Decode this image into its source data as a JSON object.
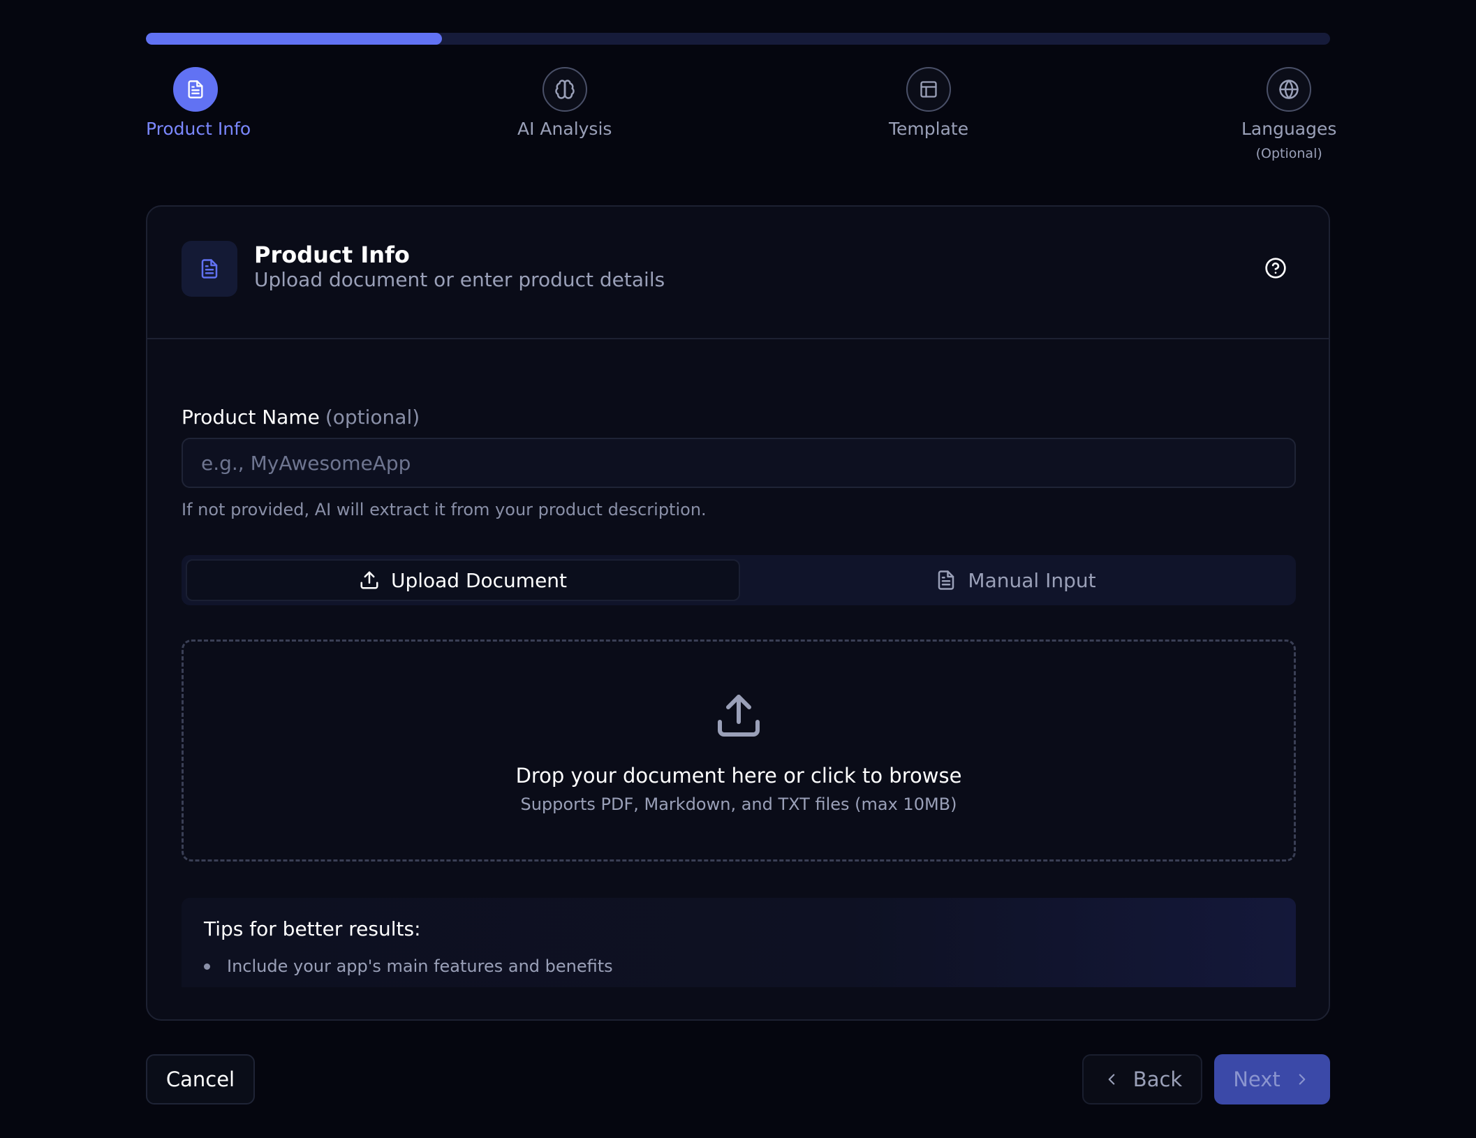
{
  "progress": {
    "fraction": 0.25,
    "fill_color": "#6172f3"
  },
  "steps": [
    {
      "label": "Product Info",
      "icon": "file-text-icon",
      "active": true
    },
    {
      "label": "AI Analysis",
      "icon": "brain-icon",
      "active": false
    },
    {
      "label": "Template",
      "icon": "layout-icon",
      "active": false
    },
    {
      "label": "Languages",
      "sub": "(Optional)",
      "icon": "globe-icon",
      "active": false
    }
  ],
  "card": {
    "title": "Product Info",
    "subtitle": "Upload document or enter product details",
    "help_icon": "help-circle-icon"
  },
  "product_name": {
    "label": "Product Name",
    "optional": "(optional)",
    "placeholder": "e.g., MyAwesomeApp",
    "value": "",
    "hint": "If not provided, AI will extract it from your product description."
  },
  "tabs": [
    {
      "label": "Upload Document",
      "icon": "upload-icon",
      "active": true
    },
    {
      "label": "Manual Input",
      "icon": "file-text-icon",
      "active": false
    }
  ],
  "dropzone": {
    "title": "Drop your document here or click to browse",
    "subtitle": "Supports PDF, Markdown, and TXT files (max 10MB)"
  },
  "tips": {
    "title": "Tips for better results:",
    "items": [
      "Include your app's main features and benefits"
    ]
  },
  "footer": {
    "cancel": "Cancel",
    "back": "Back",
    "next": "Next"
  },
  "colors": {
    "accent": "#6172f3",
    "background": "#05060f",
    "next_button": "#3b49a8"
  }
}
